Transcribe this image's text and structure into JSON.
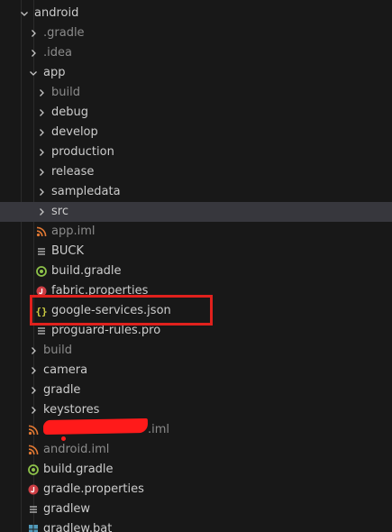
{
  "tree": {
    "android": "android",
    "gradle_dir": ".gradle",
    "idea_dir": ".idea",
    "app": "app",
    "app_children": {
      "build": "build",
      "debug": "debug",
      "develop": "develop",
      "production": "production",
      "release": "release",
      "sampledata": "sampledata",
      "src": "src",
      "app_iml": "app.iml",
      "buck": "BUCK",
      "build_gradle": "build.gradle",
      "fabric_properties": "fabric.properties",
      "google_services": "google-services.json",
      "proguard_rules": "proguard-rules.pro"
    },
    "build": "build",
    "camera": "camera",
    "gradle": "gradle",
    "keystores": "keystores",
    "redacted_iml_suffix": ".iml",
    "android_iml": "android.iml",
    "root_build_gradle": "build.gradle",
    "gradle_properties": "gradle.properties",
    "gradlew": "gradlew",
    "gradlew_bat": "gradlew.bat"
  },
  "colors": {
    "background": "#181818",
    "selected_row": "#37373d",
    "text": "#cccccc",
    "ignored_text": "#8b8b8b",
    "annotation_red": "#e0211d",
    "gradle_icon_green": "#8dc149",
    "json_icon_yellow": "#cbcb41",
    "xml_icon_orange": "#e37933",
    "properties_icon_red": "#cc3e44",
    "windows_icon_blue": "#519aba"
  }
}
